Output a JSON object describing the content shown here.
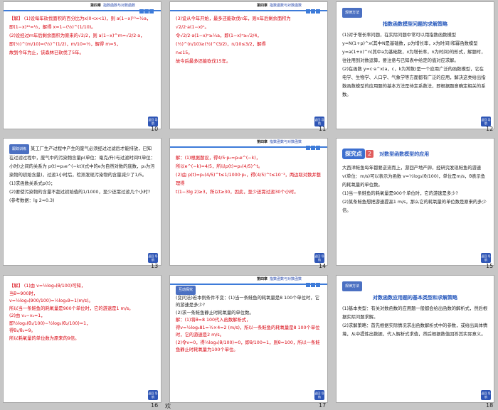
{
  "header": {
    "chapter": "第四章",
    "title": "指数函数与对数函数"
  },
  "back_button": "返回\n导航",
  "slides": [
    {
      "page": "10",
      "lines": [
        "【解】 (1)设每年砍伐面积的百分比为x(0<x<1)，则 a(1−x)¹⁰=½a，",
        "即(1−x)¹⁰=½，解得 x=1−(½)^(1/10)。",
        "(2)设经过m年后剩余面积为原来的√2/2，则 a(1−x)^m=√2/2·a，",
        "即(½)^(m/10)=(½)^(1/2)，m/10=½，解得 m=5，",
        "故到今年为止，该森林已砍伐了5年。"
      ]
    },
    {
      "page": "11",
      "lines": [
        "(3)设从今年开始，最多还能砍伐n年，则n年后剩余面积为√2/2·a(1−x)ⁿ。",
        "令√2/2·a(1−x)ⁿ≥¼a，即(1−x)ⁿ≥√2/4，",
        "(½)^(n/10)≥(½)^(3/2)，n/10≤3/2，解得",
        "n≤15。",
        "故今后最多还能砍伐15年。"
      ]
    },
    {
      "page": "12",
      "label": "规律方法",
      "heading": "指数函数模型问题的求解策略",
      "lines": [
        "(1)对于增长率问题，在实际问题中常可以用指数函数模型 y=N(1+p)^x(其中N是基础数，p为增长率，x为时间)和幂函数模型 y=a(1+x)^n(其中a为基础数，x为增长率，n为时间)的形式，解题时，往往用到对数运算，要注意与已知表中给定的值对应求解。",
        "(2)在函数 y=c·a^x(a，c，k为常数)是一个应用广泛的函数模型，它在电学、生物学、人口学、气象学等方面都有广泛的应用，解决这类给出指数函数模型的应用题的基本方法是待定系数法，即根据题意确定相关的系数。"
      ]
    },
    {
      "page": "13",
      "label": "跟踪训练",
      "lines": [
        "某工厂生产过程中产生的废气必须经过过滤后才能排放，已知在过滤过程中，废气中的污染物含量p(单位：毫克/升)与过滤时间t(单位：小时)之间的关系为 p(t)=p₀e^(−kt)(式中的e为自然对数的底数，p₀为污染物的初始含量)，过滤1小时后，检测发现污染物的含量减少了1/5。",
        "(1)求函数关系式p(t)；",
        "(2)要使污染物的含量不超过初始值的1/1000，至少还需过滤几个小时?(参考数据：lg 2≈0.3)"
      ]
    },
    {
      "page": "14",
      "lines": [
        "解：(1)根据题设，得4/5·p₀=p₀e^(−k)，",
        "所以e^(−k)=4/5，所以p(t)=p₀(4/5)^t。",
        "(2)由 p(t)=p₀(4/5)^t≤1/1000·p₀，得(4/5)^t≤10⁻³，两边取对数并整理得",
        "t(1−3lg 2)≥3，所以t≥30，因此，至少还需过滤30个小时。"
      ]
    },
    {
      "page": "15",
      "tag": "探究点",
      "tag_num": "2",
      "title": "对数型函数模型的应用",
      "lines": [
        "大西洋鲑鱼每年都要逆流而上，游回产地产卵，经研究发现鲑鱼的游速v(单位：m/s)可以表示为函数 v=½log₃(θ/100)，单位是m/s，θ表示鱼的耗氧量的单位数。",
        "(1)当一条鲑鱼的耗氧量是900个单位时，它的游速是多少?",
        "(2)某条鲑鱼想把游速提高1 m/s，那么它的耗氧量的单位数是原来的多少倍。"
      ]
    },
    {
      "page": "16",
      "lines": [
        "【解】 (1)由 v=½log₃(θ/100)可知，",
        "当θ=900时，",
        "v=½log₃(900/100)=½log₃9=1(m/s)。",
        "所以当一条鲑鱼的耗氧量是900个单位时，它的游速是1 m/s。",
        "(2)由 v₁−v₂=1，",
        "即½log₃(θ₁/100)−½log₃(θ₂/100)=1，",
        "得θ₁/θ₂=9。",
        "所以耗氧量的单位数为原来的9倍。"
      ]
    },
    {
      "page": "17",
      "label": "互动探究",
      "lines": [
        "(变问法)若本例条件不变：(1)当一条鲑鱼的耗氧量是8 100个单位时，它的游速是多少?",
        "(2)求一条鲑鱼静止时耗氧量的单位数。",
        "解：(1)将θ=8 100代入函数解析式，",
        "得v=½log₃81=½×4=2 (m/s)，所以一条鲑鱼的耗氧量是8 100个单位时，它的游速是2 m/s。",
        "(2)令v=0，得½log₃(θ/100)=0，即θ/100=1，则θ=100，所以一条鲑鱼静止时耗氧量为100个单位。"
      ]
    },
    {
      "page": "18",
      "label": "规律方法",
      "heading": "对数函数应用题的基本类型和求解策略",
      "lines": [
        "(1)基本类型：有关对数函数的应用题一般都会给出函数的解析式，然后根据实际问题求解。",
        "(2)求解策略：首先根据实际情况求出函数解析式中的参数，或给出具体情境，从中提炼出数据，代入解析式求值，然后根据数值回答其实际意义。"
      ]
    }
  ],
  "footer_text": "欢"
}
